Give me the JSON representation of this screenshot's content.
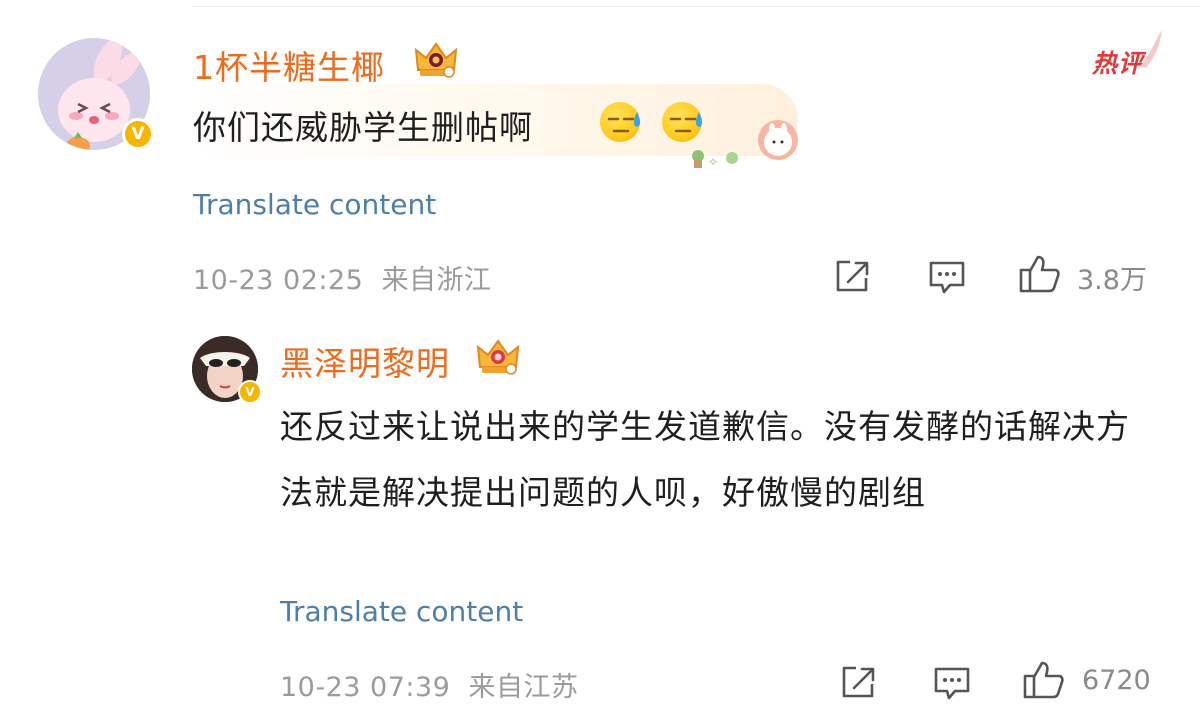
{
  "comments": [
    {
      "username": "1杯半糖生椰",
      "text": "你们还威胁学生删帖啊",
      "badge": "热评",
      "translate_label": "Translate content",
      "timestamp": "10-23 02:25",
      "location": "来自浙江",
      "like_count": "3.8万"
    }
  ],
  "reply": {
    "username": "黑泽明黎明",
    "text": "还反过来让说出来的学生发道歉信。没有发酵的话解决方法就是解决提出问题的人呗，好傲慢的剧组",
    "translate_label": "Translate content",
    "timestamp": "10-23 07:39",
    "location": "来自江苏",
    "like_count": "6720"
  },
  "colors": {
    "username": "#ee6b1d",
    "link": "#4f7fa8",
    "meta": "#9b9b9b",
    "hot_badge": "#e5383b",
    "verify": "#f7b500"
  },
  "icons": [
    "verified-badge-icon",
    "crown-level-icon",
    "downcast-sweat-emoji-icon",
    "share-icon",
    "comment-icon",
    "like-icon"
  ]
}
